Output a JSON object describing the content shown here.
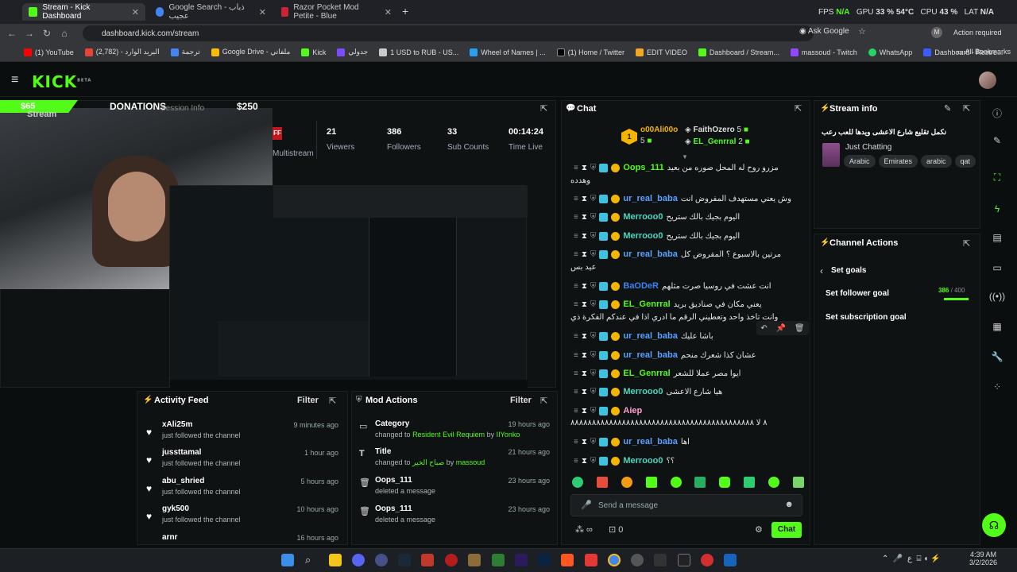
{
  "browser": {
    "tabs": [
      {
        "label": "Stream - Kick Dashboard",
        "active": true,
        "color": "#53fc18"
      },
      {
        "label": "Google Search - ذباب عجيب",
        "active": false,
        "color": "#4285f4"
      },
      {
        "label": "Razor Pocket Mod Petite - Blue",
        "active": false,
        "color": "#c23"
      }
    ],
    "url": "dashboard.kick.com/stream",
    "account_label": "Ask Google",
    "action_required": "Action required",
    "perf": {
      "fps_label": "FPS",
      "fps": "N/A",
      "gpu_label": "GPU",
      "gpu": "33 %  54°C",
      "cpu_label": "CPU",
      "cpu": "43 %",
      "lat_label": "LAT",
      "lat": "N/A"
    },
    "bookmarks": [
      "(1) YouTube",
      "(2,782) - البريد الوارد",
      "ترجمة",
      "Google Drive - ملفاتي",
      "Kick",
      "جدولي",
      "1 USD to RUB - US...",
      "Wheel of Names | ...",
      "(1) Home / Twitter",
      "EDIT VIDEO",
      "Dashboard / Stream...",
      "massoud - Twitch",
      "WhatsApp",
      "Dashboard - Restre..."
    ],
    "all_bookmarks": "All Bookmarks"
  },
  "kick": {
    "logo": "KICK",
    "beta": "BETA",
    "donation_overlay": {
      "left_amount": "$65",
      "title": "DONATIONS",
      "right_amount": "$250"
    },
    "stream_panel": {
      "title": "Stream",
      "session_info": "Session Info",
      "multistream": "Multistream",
      "ff": "FF"
    },
    "stats": [
      {
        "value": "21",
        "label": "Viewers"
      },
      {
        "value": "386",
        "label": "Followers"
      },
      {
        "value": "33",
        "label": "Sub Counts"
      },
      {
        "value": "00:14:24",
        "label": "Time Live"
      }
    ],
    "activity_feed": {
      "title": "Activity Feed",
      "filter": "Filter",
      "items": [
        {
          "name": "xAli25m",
          "sub": "just followed the channel",
          "time": "9 minutes ago"
        },
        {
          "name": "jussttamal",
          "sub": "just followed the channel",
          "time": "1 hour ago"
        },
        {
          "name": "abu_shried",
          "sub": "just followed the channel",
          "time": "5 hours ago"
        },
        {
          "name": "gyk500",
          "sub": "just followed the channel",
          "time": "10 hours ago"
        },
        {
          "name": "arnr",
          "sub": "",
          "time": "16 hours ago"
        }
      ]
    },
    "mod_actions": {
      "title": "Mod Actions",
      "filter": "Filter",
      "items": [
        {
          "name": "Category",
          "sub_prefix": "changed to",
          "sub_value": "Resident Evil Requiem",
          "sub_by_prefix": "by",
          "sub_by": "IIYonko",
          "time": "19 hours ago",
          "icon": "folder"
        },
        {
          "name": "Title",
          "sub_prefix": "changed to",
          "sub_value": "صباح الخير",
          "sub_by_prefix": "by",
          "sub_by": "massoud",
          "time": "21 hours ago",
          "icon": "T"
        },
        {
          "name": "Oops_111",
          "sub_prefix": "deleted a message",
          "sub_value": "",
          "sub_by_prefix": "",
          "sub_by": "",
          "time": "23 hours ago",
          "icon": "trash"
        },
        {
          "name": "Oops_111",
          "sub_prefix": "deleted a message",
          "sub_value": "",
          "sub_by_prefix": "",
          "sub_by": "",
          "time": "23 hours ago",
          "icon": "trash"
        }
      ]
    },
    "chat": {
      "title": "Chat",
      "top_gifters": [
        {
          "name": "o00Ali00o",
          "count": "5",
          "rank": "1"
        },
        {
          "name": "FaithOzero",
          "count": "5"
        },
        {
          "name": "EL_Genrral",
          "count": "2"
        }
      ],
      "messages": [
        {
          "user": "Oops_111",
          "color": "#53fc18",
          "text": "مزرو روح له المحل صوره من بعيد",
          "cont": "وهدده"
        },
        {
          "user": "ur_real_baba",
          "color": "#5aa0ff",
          "text": "وش يعني مستهدف المفروض انت"
        },
        {
          "user": "Merrooo0",
          "color": "#4ad6c0",
          "text": "اليوم بجيك بالك ستريح"
        },
        {
          "user": "Merrooo0",
          "color": "#4ad6c0",
          "text": "اليوم بجيك بالك ستريح"
        },
        {
          "user": "ur_real_baba",
          "color": "#5aa0ff",
          "text": "مرتين بالاسبوع ؟ المفروض كل",
          "cont": "عيد بس"
        },
        {
          "user": "BaODeR",
          "color": "#3b82f6",
          "text": "انت عشت في روسيا صرت مثلهم"
        },
        {
          "user": "EL_Genrral",
          "color": "#53fc18",
          "text": "يعني مكان في صناديق بريد",
          "cont": "وانت تاخذ واحد وتعطيني الرقم ما ادري اذا في عندكم الفكرة ذي"
        },
        {
          "user": "ur_real_baba",
          "color": "#5aa0ff",
          "text": "باشا عليك"
        },
        {
          "user": "ur_real_baba",
          "color": "#5aa0ff",
          "text": "عشان كذا شعرك منحم"
        },
        {
          "user": "EL_Genrral",
          "color": "#53fc18",
          "text": "ايوا مصر عملا للشعر"
        },
        {
          "user": "Merrooo0",
          "color": "#4ad6c0",
          "text": "هيا شارع الاعشى"
        },
        {
          "user": "Aiep",
          "color": "#ff9fd6",
          "text": "",
          "cont": "٨ لا ٨٨٨٨٨٨٨٨٨٨٨٨٨٨٨٨٨٨٨٨٨٨٨٨٨٨٨٨٨٨٨٨٨٨٨٨٨٨٨٨٨٨٨"
        },
        {
          "user": "ur_real_baba",
          "color": "#5aa0ff",
          "text": "اها"
        },
        {
          "user": "Merrooo0",
          "color": "#4ad6c0",
          "text": "؟؟"
        }
      ],
      "input_placeholder": "Send a message",
      "points_value": "0",
      "send_label": "Chat"
    },
    "stream_info": {
      "title": "Stream info",
      "stream_title": "نكمل تقليع شارع الاعشى ويدها للعب رعب",
      "category": "Just Chatting",
      "tags": [
        "Arabic",
        "Emirates",
        "arabic",
        "qat"
      ]
    },
    "channel_actions": {
      "title": "Channel Actions",
      "back_label": "Set goals",
      "follower_goal_label": "Set follower goal",
      "follower_goal_value": "386",
      "follower_goal_total": "/ 400",
      "follower_goal_fraction": 0.965,
      "subscription_goal_label": "Set subscription goal"
    }
  },
  "taskbar": {
    "time": "4:39 AM",
    "date": "3/2/2026",
    "lang": "ع"
  }
}
